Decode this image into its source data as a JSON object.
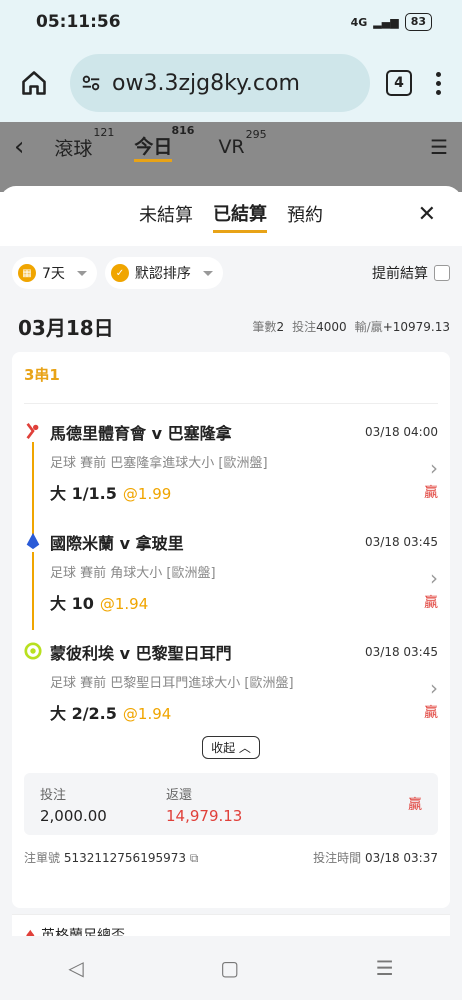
{
  "status": {
    "time": "05:11:56",
    "battery": "83",
    "signal_text": "4G"
  },
  "browser": {
    "url": "ow3.3zjg8ky.com",
    "tab_count": "4"
  },
  "bg_nav": {
    "tabs": [
      {
        "label": "滾球",
        "count": "121"
      },
      {
        "label": "今日",
        "count": "816"
      },
      {
        "label": "VR",
        "count": "295"
      }
    ]
  },
  "sheet": {
    "tabs": [
      "未結算",
      "已結算",
      "預約"
    ],
    "active_tab": "已結算"
  },
  "filters": {
    "days": "7天",
    "sort": "默認排序",
    "early_settle": "提前結算"
  },
  "date_group": {
    "date": "03月18日",
    "count_label": "筆數",
    "count": "2",
    "stake_label": "投注",
    "stake": "4000",
    "pnl_label": "輸/贏",
    "pnl": "+10979.13"
  },
  "bet": {
    "type": "3串1",
    "legs": [
      {
        "match": "馬德里體育會 v 巴塞隆拿",
        "time": "03/18 04:00",
        "desc": "足球  賽前   巴塞隆拿進球大小 [歐洲盤]",
        "pick": "大 1/1.5",
        "odds": "@1.99",
        "result": "贏",
        "logo": "laliga-icon"
      },
      {
        "match": "國際米蘭 v 拿玻里",
        "time": "03/18 03:45",
        "desc": "足球  賽前   角球大小 [歐洲盤]",
        "pick": "大 10",
        "odds": "@1.94",
        "result": "贏",
        "logo": "seriea-icon"
      },
      {
        "match": "蒙彼利埃 v 巴黎聖日耳門",
        "time": "03/18 03:45",
        "desc": "足球  賽前   巴黎聖日耳門進球大小 [歐洲盤]",
        "pick": "大 2/2.5",
        "odds": "@1.94",
        "result": "贏",
        "logo": "ligue1-icon"
      }
    ],
    "collapse_label": "收起",
    "stake_label": "投注",
    "stake": "2,000.00",
    "return_label": "返還",
    "return": "14,979.13",
    "result": "贏",
    "ticket_label": "注單號",
    "ticket": "5132112756195973",
    "bet_time_label": "投注時間",
    "bet_time": "03/18 03:37"
  },
  "next_card_preview": "英格蘭足總盃"
}
